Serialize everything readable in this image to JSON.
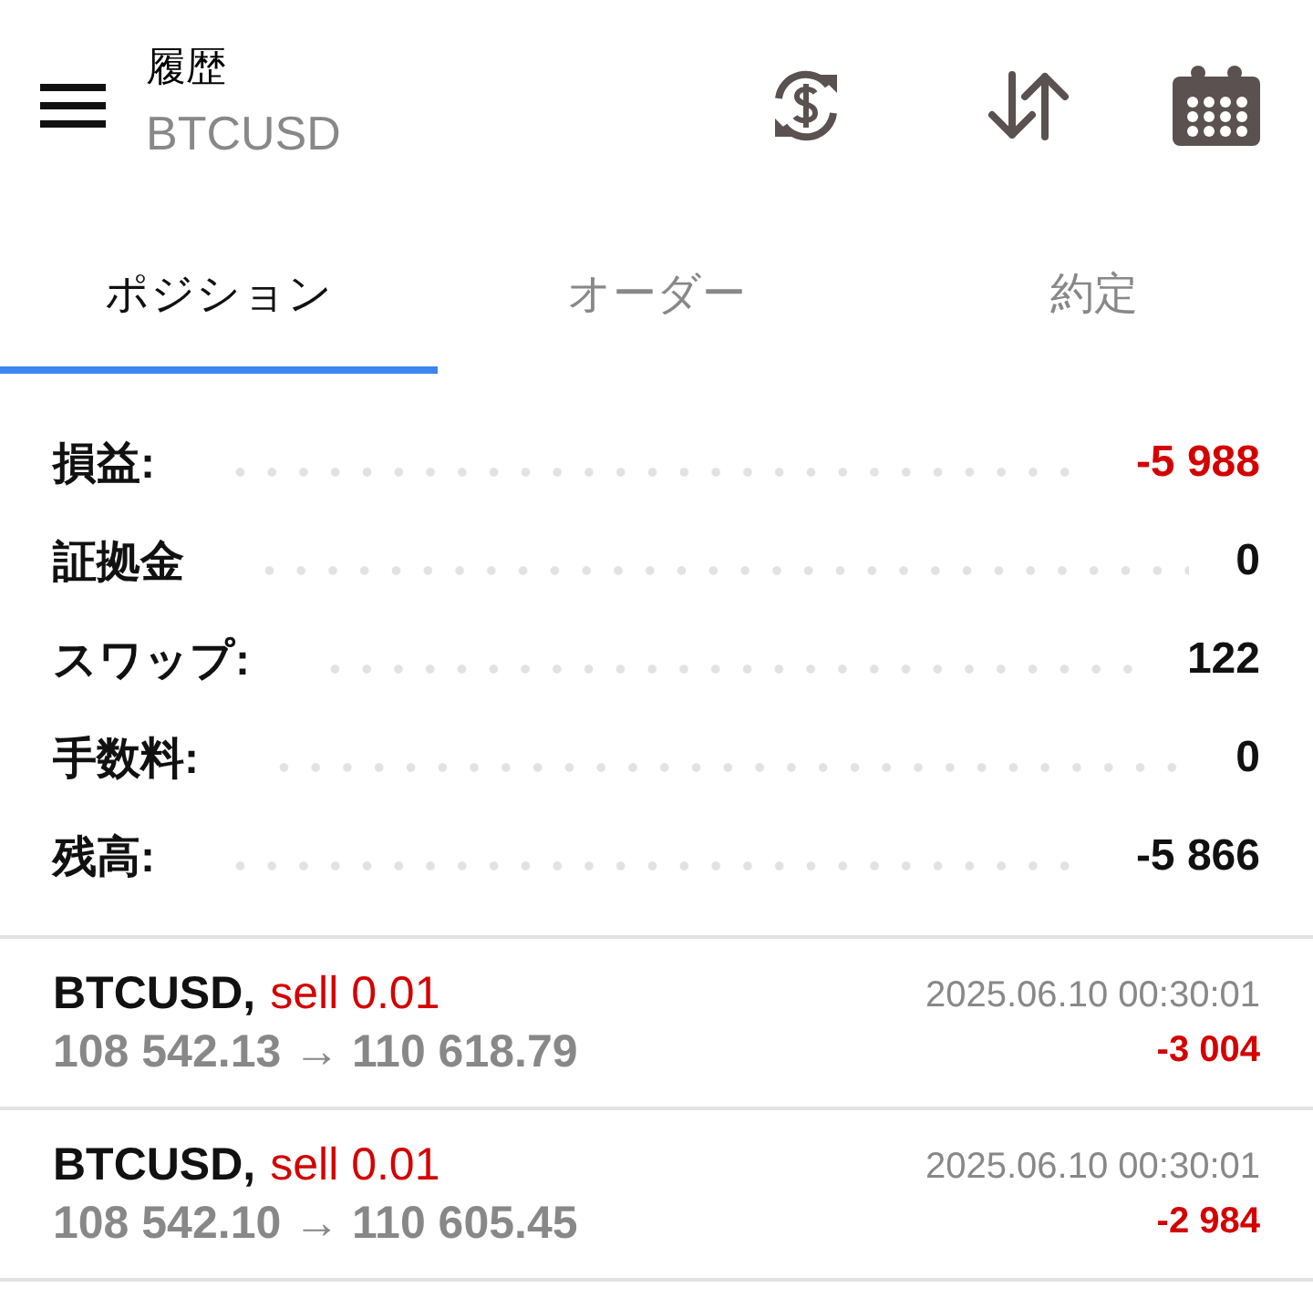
{
  "header": {
    "title": "履歴",
    "subtitle": "BTCUSD"
  },
  "tabs": [
    {
      "label": "ポジション",
      "selected": true
    },
    {
      "label": "オーダー",
      "selected": false
    },
    {
      "label": "約定",
      "selected": false
    }
  ],
  "summary": [
    {
      "label": "損益:",
      "value": "-5 988",
      "loss": true
    },
    {
      "label": "証拠金",
      "value": "0",
      "loss": false
    },
    {
      "label": "スワップ:",
      "value": "122",
      "loss": false
    },
    {
      "label": "手数料:",
      "value": "0",
      "loss": false
    },
    {
      "label": "残高:",
      "value": "-5 866",
      "loss": false
    }
  ],
  "deals": [
    {
      "symbol": "BTCUSD,",
      "order": "sell 0.01",
      "is_sell": true,
      "prices": "108 542.13 → 110 618.79",
      "time": "2025.06.10 00:30:01",
      "profit": "-3 004",
      "loss": true
    },
    {
      "symbol": "BTCUSD,",
      "order": "sell 0.01",
      "is_sell": true,
      "prices": "108 542.10 → 110 605.45",
      "time": "2025.06.10 00:30:01",
      "profit": "-2 984",
      "loss": true
    }
  ]
}
